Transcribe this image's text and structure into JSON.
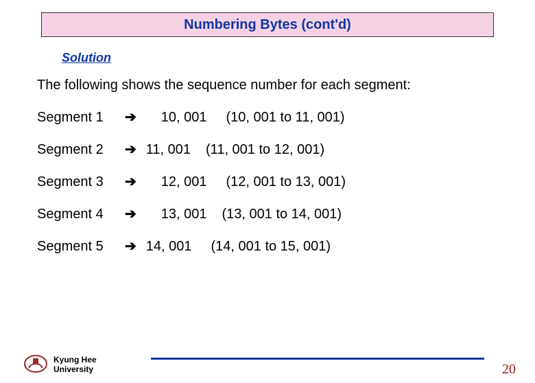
{
  "title": "Numbering Bytes (cont'd)",
  "solution_label": "Solution",
  "intro": "The following shows the sequence number for each segment:",
  "arrow_glyph": "➔",
  "segments": [
    {
      "name": "Segment 1",
      "seq": "10, 001",
      "range": "(10, 001 to 11, 001)",
      "pad": "a",
      "gap": "a"
    },
    {
      "name": "Segment 2",
      "seq": "11, 001",
      "range": "(11, 001 to 12, 001)",
      "pad": "b",
      "gap": "b"
    },
    {
      "name": "Segment 3",
      "seq": "12, 001",
      "range": "(12, 001 to 13, 001)",
      "pad": "c",
      "gap": "a"
    },
    {
      "name": "Segment 4",
      "seq": "13, 001",
      "range": "(13, 001 to 14, 001)",
      "pad": "c",
      "gap": "b"
    },
    {
      "name": "Segment 5",
      "seq": "14, 001",
      "range": "(14, 001 to 15, 001)",
      "pad": "d",
      "gap": "a"
    }
  ],
  "footer": {
    "university_line1": "Kyung Hee",
    "university_line2": "University",
    "page_number": "20"
  }
}
